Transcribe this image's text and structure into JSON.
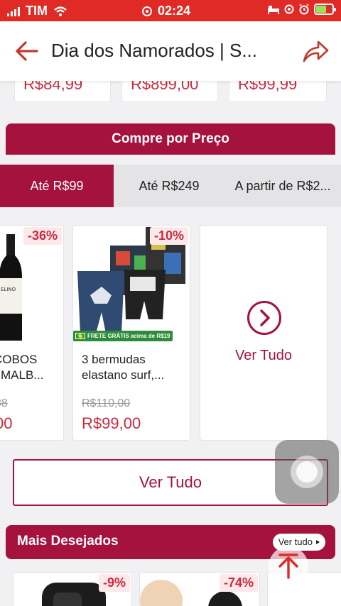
{
  "status_bar": {
    "carrier": "TIM",
    "time": "02:24"
  },
  "header": {
    "title": "Dia dos Namorados | S..."
  },
  "top_prices": [
    "R$84,99",
    "R$899,00",
    "R$99,99"
  ],
  "price_section": {
    "title": "Compre por Preço",
    "tabs": [
      {
        "label": "Até R$99",
        "active": true
      },
      {
        "label": "Até R$249",
        "active": false
      },
      {
        "label": "A partir de R$2...",
        "active": false
      }
    ]
  },
  "products": [
    {
      "badge": "-36%",
      "name_line1": "COBOS",
      "name_line2": "MALB...",
      "old_price": "88",
      "price": "00"
    },
    {
      "badge": "-10%",
      "name_line1": "3 bermudas",
      "name_line2": "elastano surf,...",
      "old_price": "R$110,00",
      "price": "R$99,00",
      "shipping_tag": "FRETE GRÁTIS acima de R$19"
    }
  ],
  "see_all_card": {
    "label": "Ver Tudo"
  },
  "see_all_button": {
    "label": "Ver Tudo"
  },
  "most_wanted": {
    "title": "Mais Desejados",
    "link": "Ver tudo",
    "badges": [
      "-9%",
      "-74%"
    ]
  },
  "colors": {
    "brand": "#a4123d",
    "status_bar": "#e02a26",
    "price": "#c92a3f"
  }
}
